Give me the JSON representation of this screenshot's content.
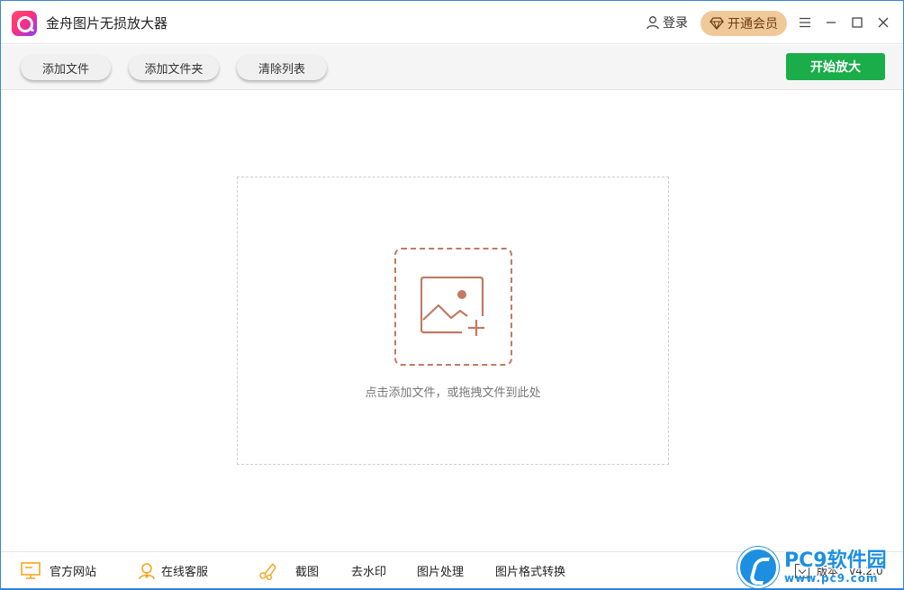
{
  "app": {
    "title": "金舟图片无损放大器"
  },
  "header": {
    "login_label": "登录",
    "vip_label": "开通会员"
  },
  "toolbar": {
    "add_file": "添加文件",
    "add_folder": "添加文件夹",
    "clear_list": "清除列表",
    "start": "开始放大"
  },
  "dropzone": {
    "hint": "点击添加文件，或拖拽文件到此处"
  },
  "footer": {
    "official_site": "官方网站",
    "online_service": "在线客服",
    "screenshot": "截图",
    "remove_watermark": "去水印",
    "image_process": "图片处理",
    "format_convert": "图片格式转换",
    "version": "版本：v4.2.0"
  },
  "watermark": {
    "main": "PC9软件园",
    "sub": "www.pc9.com"
  },
  "icons": {
    "app": "app-logo-icon",
    "user": "user-icon",
    "vip": "diamond-icon",
    "menu": "menu-icon",
    "minimize": "minimize-icon",
    "maximize": "maximize-icon",
    "close": "close-icon",
    "add_image": "image-add-icon",
    "monitor": "monitor-icon",
    "service": "headset-user-icon",
    "scissors": "scissors-icon"
  },
  "colors": {
    "primary_green": "#1aad49",
    "vip_gold": "#f0c99b",
    "accent_brown": "#c07a64",
    "footer_orange": "#f5a623",
    "window_border": "#3b87d6"
  }
}
